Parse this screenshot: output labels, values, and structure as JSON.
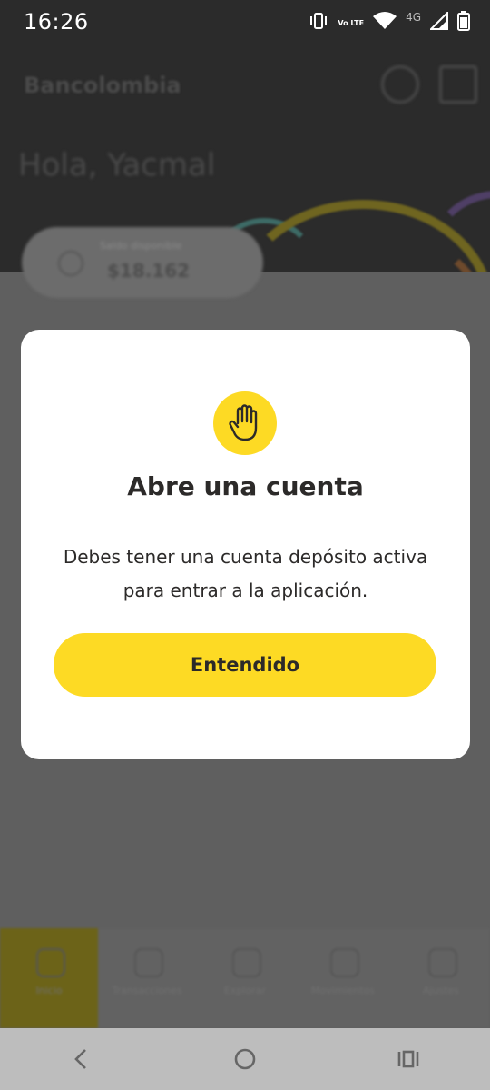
{
  "status_bar": {
    "time": "16:26",
    "volte_label": "Vo LTE",
    "network_label": "4G",
    "icons": [
      "vibrate-icon",
      "volte-icon",
      "wifi-icon",
      "signal-icon",
      "battery-icon"
    ]
  },
  "background": {
    "brand": "Bancolombia",
    "greeting": "Hola, Yacmal",
    "balance_label": "Saldo disponible",
    "balance_value": "$18.162",
    "nav_items": [
      {
        "label": "Inicio",
        "icon": "home-icon"
      },
      {
        "label": "Transacciones",
        "icon": "wallet-icon"
      },
      {
        "label": "Explorar",
        "icon": "grid-icon"
      },
      {
        "label": "Movimientos",
        "icon": "calendar-icon"
      },
      {
        "label": "Ajustes",
        "icon": "settings-icon"
      }
    ]
  },
  "dialog": {
    "icon": "hand-stop-icon",
    "title": "Abre una cuenta",
    "body": "Debes tener una cuenta depósito activa para entrar a la aplicación.",
    "button_label": "Entendido"
  },
  "colors": {
    "accent": "#fdda24",
    "text": "#2c2a29",
    "overlay": "#5f5f5f",
    "header_bg": "#2b2b2b"
  },
  "system_nav": {
    "items": [
      "back-icon",
      "home-circle-icon",
      "recents-icon"
    ]
  }
}
